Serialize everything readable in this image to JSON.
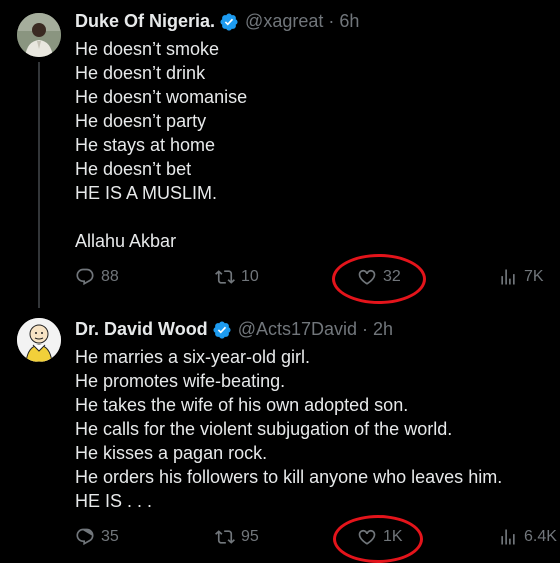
{
  "tweets": [
    {
      "name": "Duke Of Nigeria.",
      "handle": "@xagreat",
      "separator": "·",
      "time": "6h",
      "lines": [
        "He doesn’t smoke",
        "He doesn’t drink",
        "He doesn’t womanise",
        "He doesn’t party",
        "He stays at home",
        "He doesn’t bet",
        "HE IS A MUSLIM.",
        "",
        "Allahu Akbar"
      ],
      "replies": "88",
      "retweets": "10",
      "likes": "32",
      "views": "7K"
    },
    {
      "name": "Dr. David Wood",
      "handle": "@Acts17David",
      "separator": "·",
      "time": "2h",
      "lines": [
        "He marries a six-year-old girl.",
        "He promotes wife-beating.",
        "He takes the wife of his own adopted son.",
        "He calls for the violent subjugation of the world.",
        "He kisses a pagan rock.",
        "He orders his followers to kill anyone who leaves him.",
        "HE IS . . ."
      ],
      "replies": "35",
      "retweets": "95",
      "likes": "1K",
      "views": "6.4K"
    }
  ],
  "colors": {
    "background": "#000000",
    "text": "#e7e9ea",
    "muted": "#71767b",
    "verified": "#1d9bf0",
    "highlight_circle": "#e4141b"
  },
  "icons": [
    "verified-badge-icon",
    "reply-icon",
    "retweet-icon",
    "like-icon",
    "views-icon"
  ]
}
